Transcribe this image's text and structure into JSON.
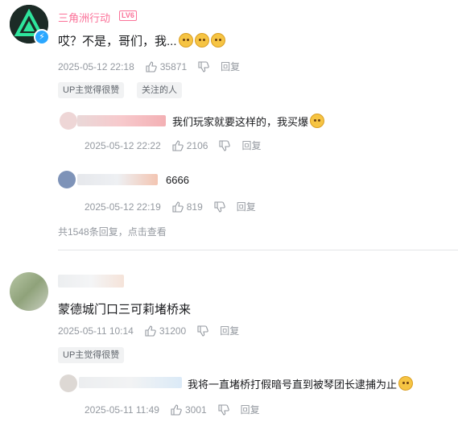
{
  "comment1": {
    "username": "三角洲行动",
    "level_badge": "LV6",
    "text": "哎？不是，哥们，我...",
    "time": "2025-05-12 22:18",
    "likes": "35871",
    "reply_label": "回复",
    "tags": [
      "UP主觉得很赞",
      "关注的人"
    ],
    "replies": [
      {
        "text": "我们玩家就要这样的，我买爆",
        "time": "2025-05-12 22:22",
        "likes": "2106",
        "reply_label": "回复"
      },
      {
        "text": "6666",
        "time": "2025-05-12 22:19",
        "likes": "819",
        "reply_label": "回复"
      }
    ],
    "more_replies": "共1548条回复，点击查看"
  },
  "comment2": {
    "text": "蒙德城门口三可莉堵桥来",
    "time": "2025-05-11 10:14",
    "likes": "31200",
    "reply_label": "回复",
    "tags": [
      "UP主觉得很赞"
    ],
    "replies": [
      {
        "text": "我将一直堵桥打假暗号直到被琴团长逮捕为止",
        "time": "2025-05-11 11:49",
        "likes": "3001",
        "reply_label": "回复"
      }
    ]
  },
  "icons": [
    "thumb-up-icon",
    "thumb-down-icon",
    "emoji-icon",
    "bolt-badge-icon"
  ],
  "colors": {
    "username_accent": "#fb7299",
    "meta_gray": "#9499a0",
    "tag_bg": "#f1f2f3"
  }
}
